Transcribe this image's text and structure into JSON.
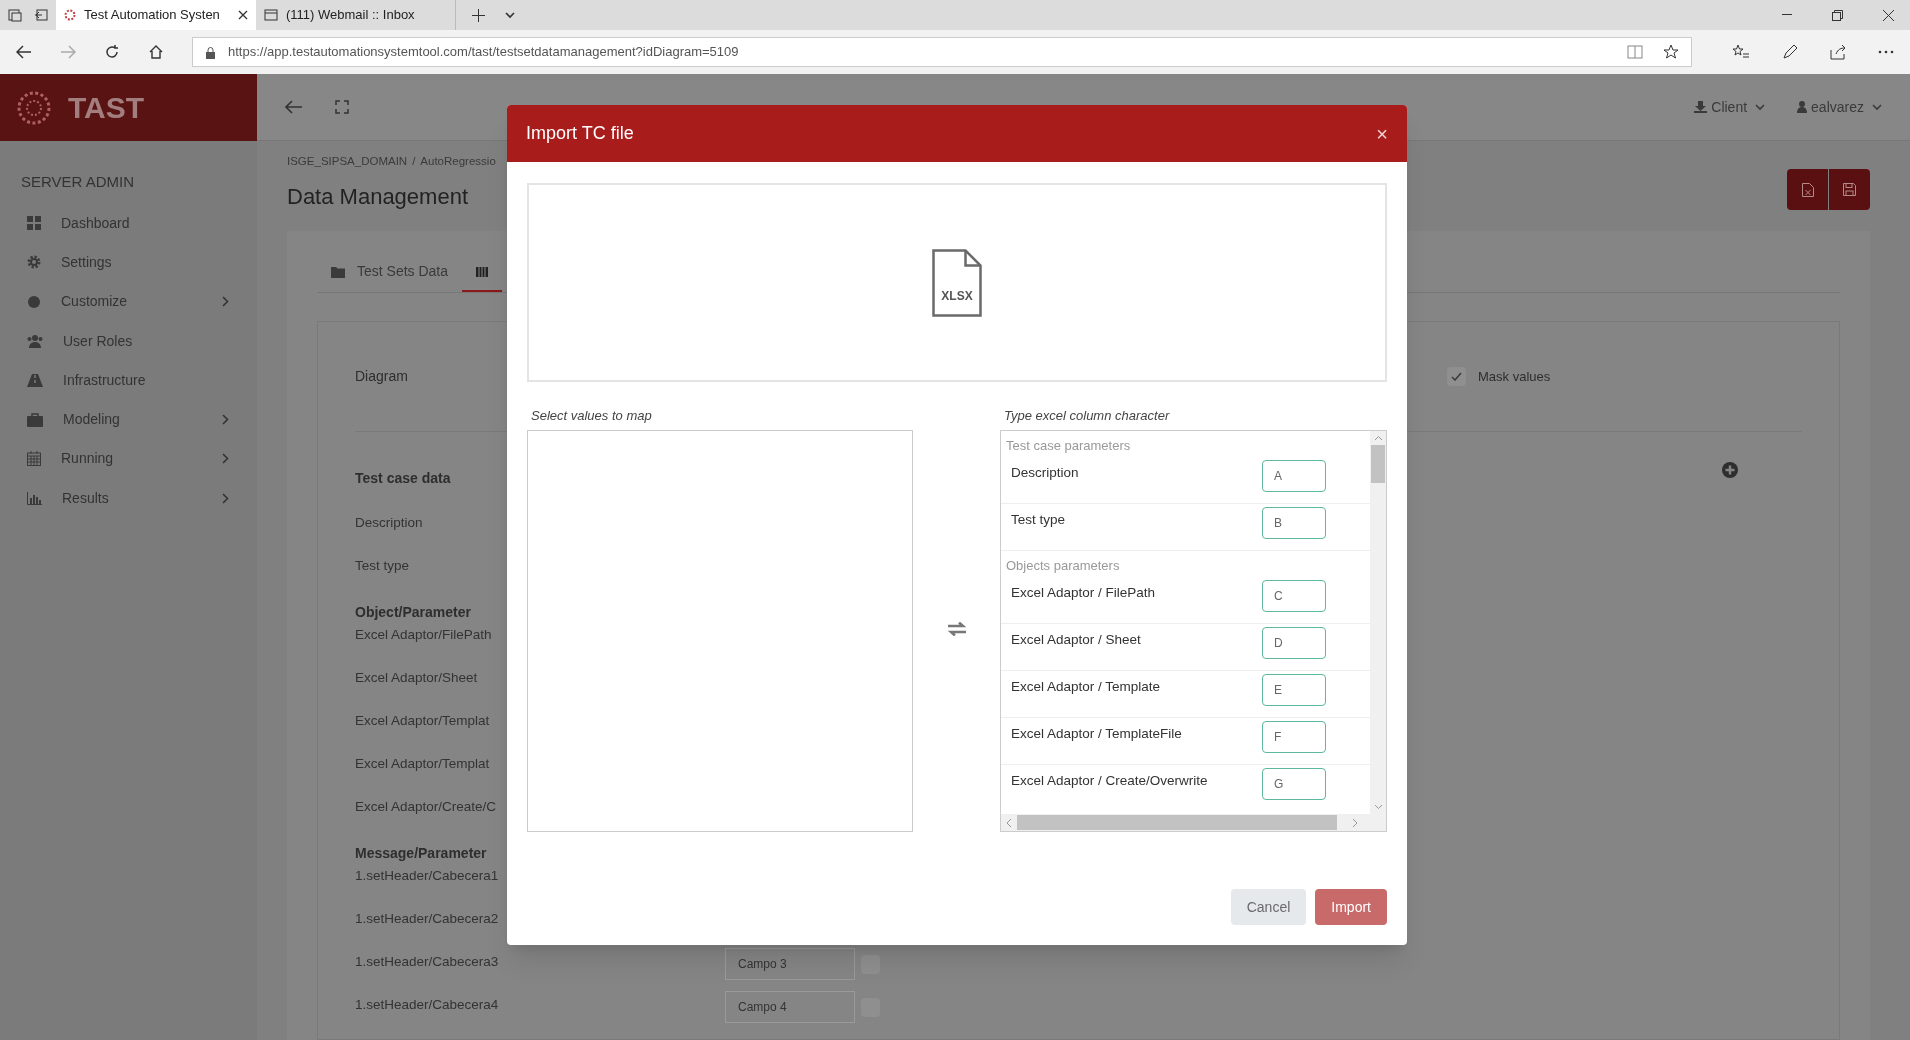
{
  "browser": {
    "tabs": [
      {
        "title": "Test Automation Systen",
        "selected": true
      },
      {
        "title": "(111) Webmail :: Inbox",
        "selected": false
      }
    ],
    "url": "https://app.testautomationsystemtool.com/tast/testsetdatamanagement?idDiagram=5109"
  },
  "app": {
    "logo": "TAST",
    "header_menus": [
      "Client",
      "ealvarez"
    ],
    "sidebar": {
      "heading": "SERVER ADMIN",
      "items": [
        {
          "label": "Dashboard",
          "has_submenu": false
        },
        {
          "label": "Settings",
          "has_submenu": false
        },
        {
          "label": "Customize",
          "has_submenu": true
        },
        {
          "label": "User Roles",
          "has_submenu": false
        },
        {
          "label": "Infrastructure",
          "has_submenu": false
        },
        {
          "label": "Modeling",
          "has_submenu": true
        },
        {
          "label": "Running",
          "has_submenu": true
        },
        {
          "label": "Results",
          "has_submenu": true
        }
      ]
    },
    "breadcrumb": [
      "ISGE_SIPSA_DOMAIN",
      "AutoRegressio"
    ],
    "breadcrumb_separator": "/",
    "page_title": "Data Management",
    "tabs": [
      {
        "label": "Test Sets Data",
        "selected": false
      },
      {
        "selected": true
      }
    ],
    "diagram_label": "Diagram",
    "mask_values": {
      "label": "Mask values",
      "checked": true
    },
    "sections": [
      {
        "heading": "Test case data",
        "items": [
          {
            "label": "Description"
          },
          {
            "label": "Test type"
          }
        ]
      },
      {
        "heading": "Object/Parameter",
        "items": [
          {
            "label": "Excel Adaptor/FilePath"
          },
          {
            "label": "Excel Adaptor/Sheet"
          },
          {
            "label": "Excel Adaptor/Templat"
          },
          {
            "label": "Excel Adaptor/Templat"
          },
          {
            "label": "Excel Adaptor/Create/C"
          }
        ]
      },
      {
        "heading": "Message/Parameter",
        "items": [
          {
            "label": "1.setHeader/Cabecera1"
          },
          {
            "label": "1.setHeader/Cabecera2"
          },
          {
            "label": "1.setHeader/Cabecera3",
            "field": "Campo 3",
            "checked": false
          },
          {
            "label": "1.setHeader/Cabecera4",
            "field": "Campo 4",
            "checked": false
          }
        ]
      }
    ]
  },
  "modal": {
    "title": "Import TC file",
    "close": "×",
    "file_type": "XLSX",
    "source_label": "Select values to map",
    "target_label": "Type excel column character",
    "groups": [
      {
        "heading": "Test case parameters",
        "params": [
          {
            "name": "Description",
            "column": "A"
          },
          {
            "name": "Test type",
            "column": "B"
          }
        ]
      },
      {
        "heading": "Objects parameters",
        "params": [
          {
            "name": "Excel Adaptor / FilePath",
            "column": "C"
          },
          {
            "name": "Excel Adaptor / Sheet",
            "column": "D"
          },
          {
            "name": "Excel Adaptor / Template",
            "column": "E"
          },
          {
            "name": "Excel Adaptor / TemplateFile",
            "column": "F"
          },
          {
            "name": "Excel Adaptor / Create/Overwrite",
            "column": "G"
          }
        ]
      }
    ],
    "buttons": [
      "Cancel",
      "Import"
    ]
  }
}
